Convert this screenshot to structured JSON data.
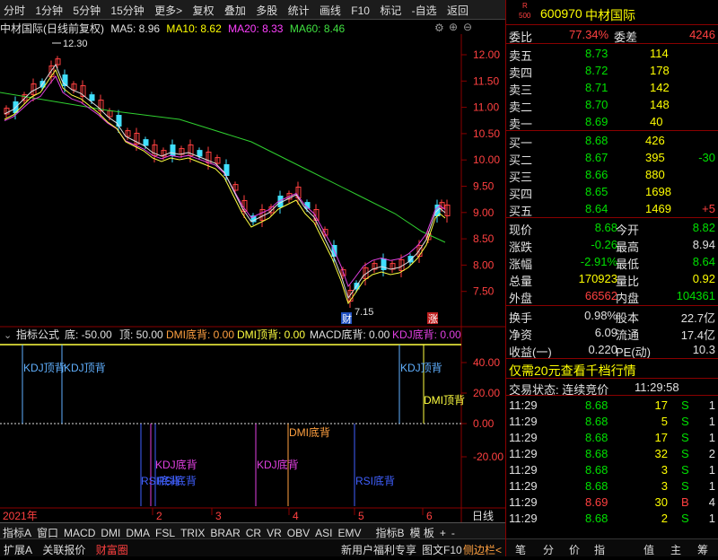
{
  "toolbar": {
    "items": [
      "分时",
      "1分钟",
      "5分钟",
      "15分钟",
      "更多>",
      "复权",
      "叠加",
      "多股",
      "统计",
      "画线",
      "F10",
      "标记",
      "-自选",
      "返回"
    ]
  },
  "chart_header": {
    "stock": "中材国际(日线前复权)",
    "ma5": "MA5: 8.96",
    "ma10": "MA10: 8.62",
    "ma20": "MA20: 8.33",
    "ma60": "MA60: 8.46"
  },
  "price_axis": [
    "12.00",
    "11.50",
    "11.00",
    "10.50",
    "10.00",
    "9.50",
    "9.00",
    "8.50",
    "8.00",
    "7.50"
  ],
  "annotations": {
    "high": "12.30",
    "low": "7.15",
    "cai": "财",
    "zhang": "涨"
  },
  "indicator_header": {
    "name": "指标公式",
    "di": "底: -50.00",
    "ding": "顶: 50.00",
    "dmi_di": "DMI底背: 0.00",
    "dmi_ding": "DMI顶背: 0.00",
    "macd_di": "MACD底背: 0.00",
    "kdj_di": "KDJ底背: 0.00"
  },
  "indicator_axis": [
    "40.00",
    "20.00",
    "0.00",
    "-20.00"
  ],
  "indicator_labels": {
    "kdj_top_1": "KDJ顶背",
    "kdj_top_2": "KDJ顶背",
    "kdj_top_3": "KDJ顶背",
    "dmi_top": "DMI顶背",
    "kdj_bottom_1": "KDJ底背",
    "kdj_bottom_2": "KDJ底背",
    "rsi_bottom_1": "RSI底背",
    "rsi_bottom_2": "RSI底背",
    "dmi_bottom": "DMI底背",
    "rsi_bottom_3": "RSI底背"
  },
  "time_axis": [
    "2021年",
    "2",
    "3",
    "4",
    "5",
    "6"
  ],
  "time_axis_corner": "日线",
  "bottom_tabs": [
    "指标A",
    "窗口",
    "MACD",
    "DMI",
    "DMA",
    "FSL",
    "TRIX",
    "BRAR",
    "CR",
    "VR",
    "OBV",
    "ASI",
    "EMV",
    "指标B",
    "模 板",
    "+",
    "-"
  ],
  "statusbar": {
    "left": [
      "扩展A",
      "关联报价",
      "财富圈"
    ],
    "right": [
      "新用户福利专享",
      "图文F10",
      "侧边栏<"
    ],
    "icons": [
      "笔",
      "分",
      "价",
      "指",
      "值",
      "主",
      "筹"
    ]
  },
  "quote": {
    "badge_top": "R",
    "badge_bottom": "500",
    "code": "600970",
    "name": "中材国际",
    "weibi_label": "委比",
    "weibi": "77.34%",
    "weicha_label": "委差",
    "weicha": "4246",
    "asks": [
      {
        "label": "卖五",
        "price": "8.73",
        "vol": "114"
      },
      {
        "label": "卖四",
        "price": "8.72",
        "vol": "178"
      },
      {
        "label": "卖三",
        "price": "8.71",
        "vol": "142"
      },
      {
        "label": "卖二",
        "price": "8.70",
        "vol": "148"
      },
      {
        "label": "卖一",
        "price": "8.69",
        "vol": "40"
      }
    ],
    "bids": [
      {
        "label": "买一",
        "price": "8.68",
        "vol": "426",
        "chg": ""
      },
      {
        "label": "买二",
        "price": "8.67",
        "vol": "395",
        "chg": "-30"
      },
      {
        "label": "买三",
        "price": "8.66",
        "vol": "880",
        "chg": ""
      },
      {
        "label": "买四",
        "price": "8.65",
        "vol": "1698",
        "chg": ""
      },
      {
        "label": "买五",
        "price": "8.64",
        "vol": "1469",
        "chg": "+5"
      }
    ],
    "stats": [
      {
        "l1": "现价",
        "v1": "8.68",
        "l2": "今开",
        "v2": "8.82"
      },
      {
        "l1": "涨跌",
        "v1": "-0.26",
        "l2": "最高",
        "v2": "8.94"
      },
      {
        "l1": "涨幅",
        "v1": "-2.91%",
        "l2": "最低",
        "v2": "8.64"
      },
      {
        "l1": "总量",
        "v1": "170923",
        "l2": "量比",
        "v2": "0.92"
      },
      {
        "l1": "外盘",
        "v1": "66562",
        "l2": "内盘",
        "v2": "104361"
      }
    ],
    "fin": [
      {
        "l1": "换手",
        "v1": "0.98%",
        "l2": "股本",
        "v2": "22.7亿"
      },
      {
        "l1": "净资",
        "v1": "6.09",
        "l2": "流通",
        "v2": "17.4亿"
      },
      {
        "l1": "收益(一)",
        "v1": "0.220",
        "l2": "PE(动)",
        "v2": "10.3"
      }
    ],
    "promo": "仅需20元查看千档行情",
    "trade_status_label": "交易状态: 连续竞价",
    "trade_status_time": "11:29:58",
    "ticks": [
      {
        "time": "11:29",
        "price": "8.68",
        "vol": "17",
        "side": "S",
        "n": "1"
      },
      {
        "time": "11:29",
        "price": "8.68",
        "vol": "5",
        "side": "S",
        "n": "1"
      },
      {
        "time": "11:29",
        "price": "8.68",
        "vol": "17",
        "side": "S",
        "n": "1"
      },
      {
        "time": "11:29",
        "price": "8.68",
        "vol": "32",
        "side": "S",
        "n": "2"
      },
      {
        "time": "11:29",
        "price": "8.68",
        "vol": "3",
        "side": "S",
        "n": "1"
      },
      {
        "time": "11:29",
        "price": "8.68",
        "vol": "3",
        "side": "S",
        "n": "1"
      },
      {
        "time": "11:29",
        "price": "8.69",
        "vol": "30",
        "side": "B",
        "n": "4"
      },
      {
        "time": "11:29",
        "price": "8.68",
        "vol": "2",
        "side": "S",
        "n": "1"
      }
    ]
  }
}
